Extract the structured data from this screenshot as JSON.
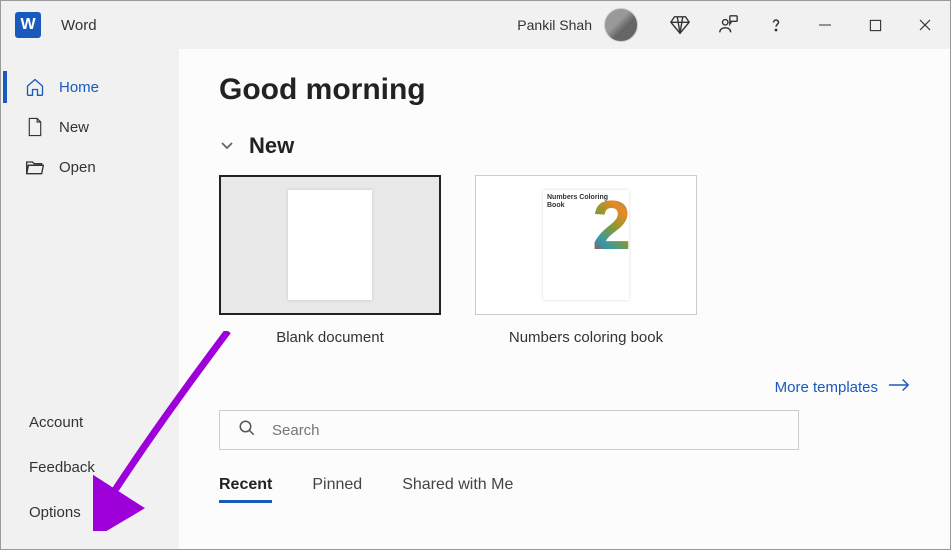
{
  "titlebar": {
    "app_title": "Word",
    "user_name": "Pankil Shah"
  },
  "sidebar": {
    "nav": [
      {
        "label": "Home",
        "active": true
      },
      {
        "label": "New",
        "active": false
      },
      {
        "label": "Open",
        "active": false
      }
    ],
    "secondary": [
      {
        "label": "Account"
      },
      {
        "label": "Feedback"
      },
      {
        "label": "Options"
      }
    ]
  },
  "main": {
    "greeting": "Good morning",
    "new_section": "New",
    "templates": [
      {
        "name": "Blank document",
        "selected": true,
        "thumb_text": ""
      },
      {
        "name": "Numbers coloring book",
        "selected": false,
        "thumb_text": "Numbers Coloring Book"
      }
    ],
    "more_link": "More templates",
    "search_placeholder": "Search",
    "tabs": [
      {
        "label": "Recent",
        "active": true
      },
      {
        "label": "Pinned",
        "active": false
      },
      {
        "label": "Shared with Me",
        "active": false
      }
    ]
  },
  "colors": {
    "accent": "#185abd",
    "annotation": "#9d00d9"
  }
}
